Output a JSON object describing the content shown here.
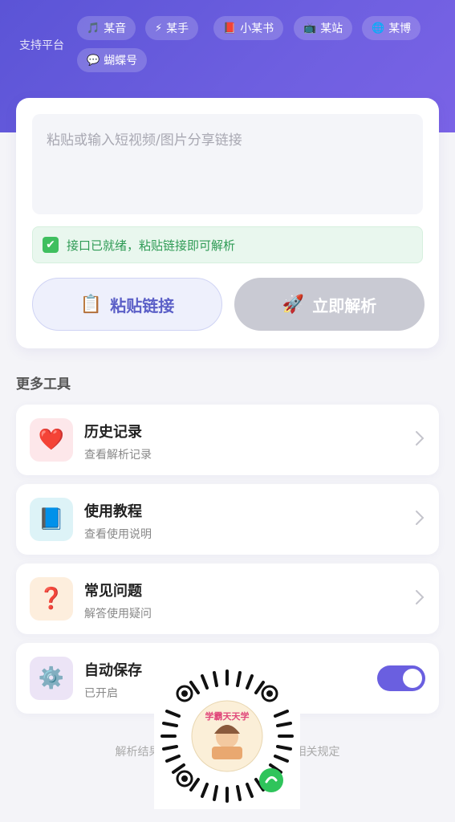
{
  "platforms": {
    "label": "支持平台",
    "chips": [
      {
        "icon": "🎵",
        "icon_name": "music-note-icon",
        "label": "某音"
      },
      {
        "icon": "⚡",
        "icon_name": "lightning-icon",
        "label": "某手"
      },
      {
        "icon": "📕",
        "icon_name": "red-book-icon",
        "label": "小某书"
      },
      {
        "icon": "📺",
        "icon_name": "tv-icon",
        "label": "某站"
      },
      {
        "icon": "🌐",
        "icon_name": "globe-icon",
        "label": "某博"
      },
      {
        "icon": "💬",
        "icon_name": "chat-bubble-icon",
        "label": "蝴蝶号"
      }
    ]
  },
  "main": {
    "input_placeholder": "粘贴或输入短视频/图片分享链接",
    "status_icon": "✔",
    "status_text": "接口已就绪，粘贴链接即可解析",
    "paste_icon": "📋",
    "paste_label": "粘贴链接",
    "parse_icon": "🚀",
    "parse_label": "立即解析"
  },
  "tools": {
    "title": "更多工具",
    "items": [
      {
        "icon": "❤️",
        "icon_name": "heart-icon",
        "title": "历史记录",
        "subtitle": "查看解析记录",
        "bg": "#fde7ea"
      },
      {
        "icon": "📘",
        "icon_name": "book-icon",
        "title": "使用教程",
        "subtitle": "查看使用说明",
        "bg": "#ddf3f7"
      },
      {
        "icon": "❓",
        "icon_name": "question-icon",
        "title": "常见问题",
        "subtitle": "解答使用疑问",
        "bg": "#fdeedd"
      },
      {
        "icon": "⚙️",
        "icon_name": "gear-icon",
        "title": "自动保存",
        "subtitle": "已开启",
        "bg": "#ece4f6"
      }
    ],
    "auto_save_enabled": true
  },
  "footer": {
    "text": "解析结果仅供个人学习使用，请遵守相关规定"
  },
  "qr": {
    "badge_text": "学霸天天学"
  },
  "colors": {
    "accent": "#6a5fe0",
    "status_green": "#2f9b55",
    "parse_disabled": "#c9cad3"
  }
}
